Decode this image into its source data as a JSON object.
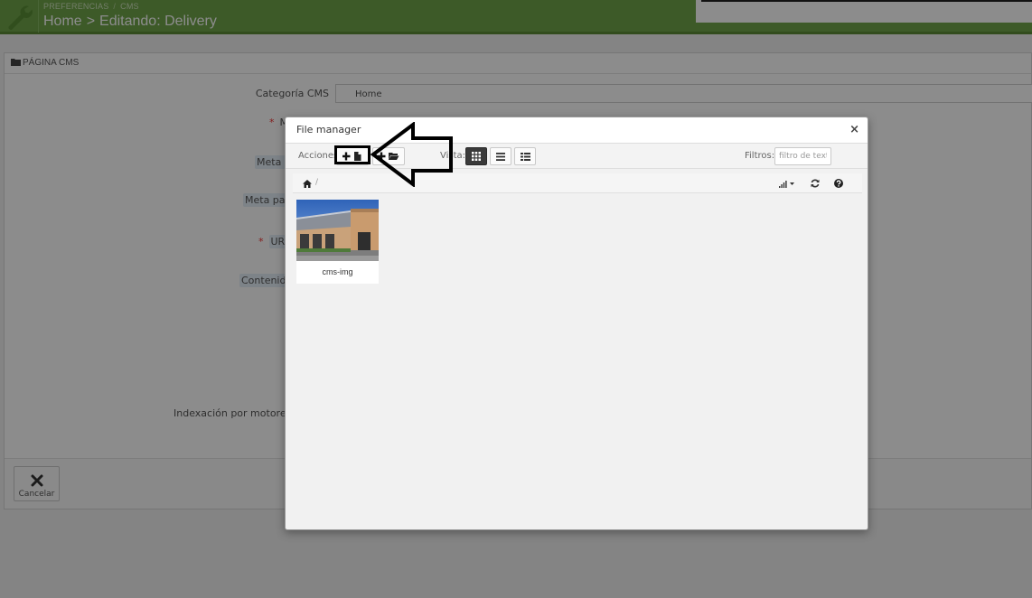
{
  "header": {
    "breadcrumb": [
      "PREFERENCIAS",
      "CMS"
    ],
    "title_parent": "Home",
    "title_separator": ">",
    "title_current": "Editando: Delivery",
    "accent_color": "#6fa44a",
    "tool_icon": "wrench-icon"
  },
  "panel": {
    "heading": "PÁGINA CMS",
    "heading_icon": "folder-icon",
    "fields": {
      "category_label": "Categoría CMS",
      "category_value": "Home",
      "meta_title_label": "M",
      "meta_description_label": "Meta de",
      "meta_keywords_label": "Meta pala",
      "url_label": "URL",
      "content_label": "Contenido",
      "indexing_label": "Indexación por motores de",
      "last_label": "I"
    },
    "cancel_label": "Cancelar"
  },
  "file_manager": {
    "title": "File manager",
    "close_glyph": "×",
    "actions_label": "Acciones",
    "view_label": "Vista:",
    "filters_label": "Filtros:",
    "filter_placeholder": "filtro de texto",
    "breadcrumb_separator": "/",
    "files": [
      {
        "name": "cms-img",
        "type": "image"
      }
    ],
    "icons": {
      "new_file": "add-file-icon",
      "new_folder": "add-folder-icon",
      "view_grid": "grid-view-icon",
      "view_list": "list-view-icon",
      "view_columns": "columns-view-icon",
      "home": "home-icon",
      "sort": "sort-icon",
      "refresh": "refresh-icon",
      "help": "help-icon"
    }
  }
}
